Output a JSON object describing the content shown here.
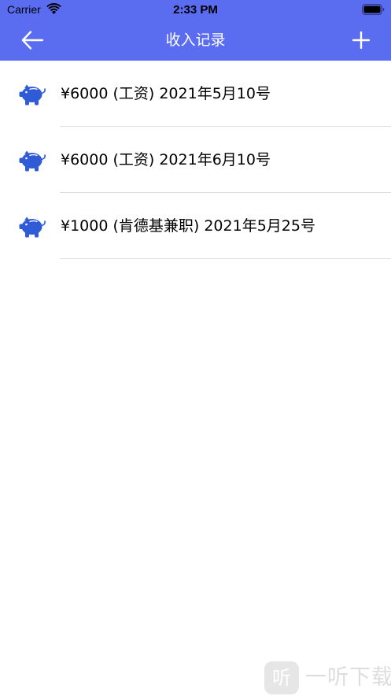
{
  "status_bar": {
    "carrier": "Carrier",
    "time": "2:33 PM",
    "wifi_icon": "wifi-icon",
    "battery_icon": "battery-icon"
  },
  "nav": {
    "title": "收入记录",
    "back_icon": "arrow-left-icon",
    "add_icon": "plus-icon",
    "background_color": "#5a6cf0"
  },
  "records": [
    {
      "icon": "piggy-bank-icon",
      "text": "¥6000 (工资) 2021年5月10号"
    },
    {
      "icon": "piggy-bank-icon",
      "text": "¥6000 (工资) 2021年6月10号"
    },
    {
      "icon": "piggy-bank-icon",
      "text": "¥1000 (肯德基兼职) 2021年5月25号"
    }
  ],
  "colors": {
    "accent": "#5a6cf0",
    "icon": "#2f5bd6",
    "divider": "#e0e0e0"
  },
  "watermark": {
    "logo_glyph": "听",
    "text": "一听下载"
  }
}
